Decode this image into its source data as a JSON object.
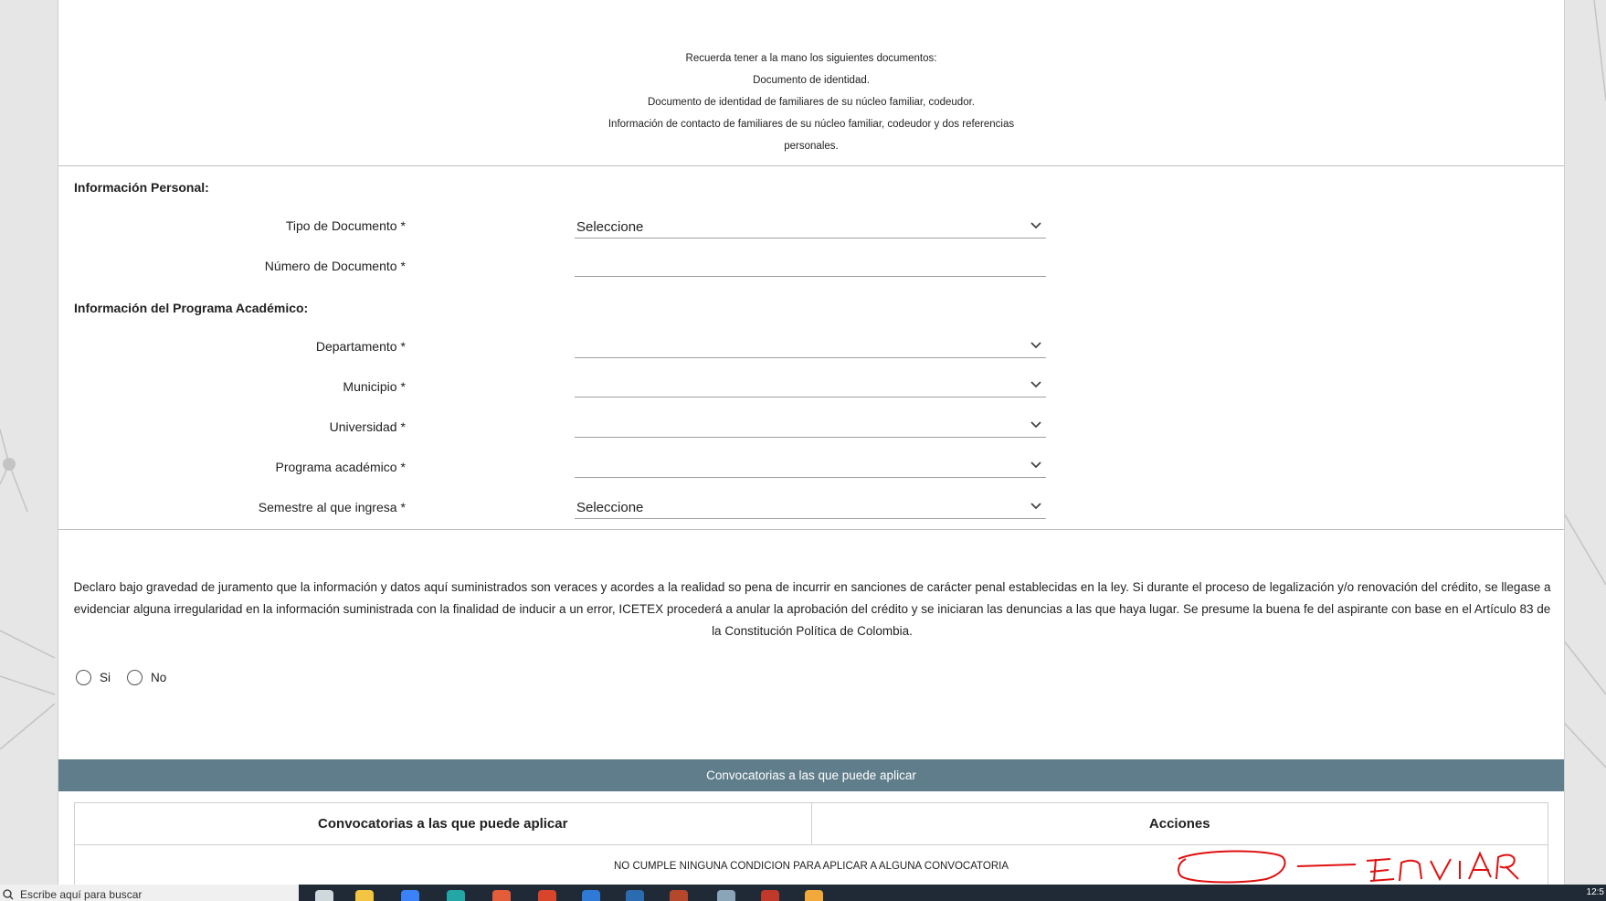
{
  "notice": {
    "lines": [
      "Recuerda tener a la mano los siguientes documentos:",
      "Documento de identidad.",
      "Documento de identidad de familiares de su núcleo familiar, codeudor.",
      "Información de contacto de familiares de su núcleo familiar, codeudor y dos referencias",
      "personales."
    ]
  },
  "personal": {
    "title": "Información Personal:",
    "tipo_documento": {
      "label": "Tipo de Documento",
      "required": "*",
      "value": "Seleccione"
    },
    "numero_documento": {
      "label": "Número de Documento",
      "required": "*",
      "value": ""
    }
  },
  "academico": {
    "title": "Información del Programa Académico:",
    "departamento": {
      "label": "Departamento",
      "required": "*",
      "value": ""
    },
    "municipio": {
      "label": "Municipio",
      "required": "*",
      "value": ""
    },
    "universidad": {
      "label": "Universidad",
      "required": "*",
      "value": ""
    },
    "programa": {
      "label": "Programa académico",
      "required": "*",
      "value": ""
    },
    "semestre": {
      "label": "Semestre al que ingresa",
      "required": "*",
      "value": "Seleccione"
    }
  },
  "declaracion": {
    "text": "Declaro bajo gravedad de juramento que la información y datos aquí suministrados son veraces y acordes a la realidad so pena de incurrir en sanciones de carácter penal establecidas en la ley. Si durante el proceso de legalización y/o renovación del crédito, se llegase a evidenciar alguna irregularidad en la información suministrada con la finalidad de inducir a un error, ICETEX procederá a anular la aprobación del crédito y se iniciaran las denuncias a las que haya lugar. Se presume la buena fe del aspirante con base en el Artículo 83 de la Constitución Política de Colombia.",
    "options": [
      "Si",
      "No"
    ]
  },
  "convocatorias": {
    "band_title": "Convocatorias a las que puede aplicar",
    "columns": [
      "Convocatorias a las que puede aplicar",
      "Acciones"
    ],
    "empty_message": "NO CUMPLE NINGUNA CONDICION PARA APLICAR A ALGUNA CONVOCATORIA"
  },
  "annotation": {
    "text": "enviar",
    "color": "#e01010"
  },
  "taskbar": {
    "search_placeholder": "Escribe aquí para buscar",
    "time": "12:5"
  },
  "colors": {
    "band": "#607d8b",
    "divider": "#bdbdbd",
    "taskbar": "#1f2a36"
  }
}
